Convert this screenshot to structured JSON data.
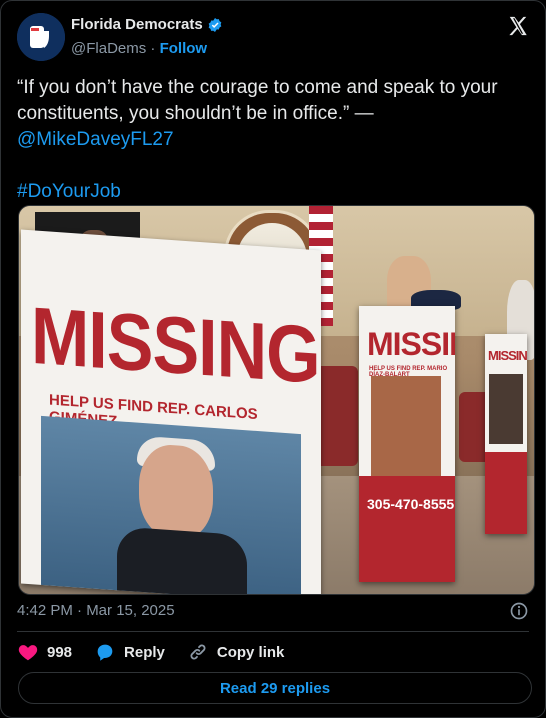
{
  "author": {
    "name": "Florida Democrats",
    "handle": "@FlaDems",
    "separator": "·",
    "follow_label": "Follow"
  },
  "tweet": {
    "text_part1": "“If you don’t have the courage to come and speak to your constituents, you shouldn’t be in office.” — ",
    "mention": "@MikeDaveyFL27",
    "hashtag": "#DoYourJob"
  },
  "media": {
    "poster_big_title": "MISSING",
    "poster_big_subtitle": "HELP US FIND REP. CARLOS GIMÉNEZ",
    "poster_mid_title": "MISSING",
    "poster_mid_subtitle": "HELP US FIND REP. MARIO DÍAZ-BALART",
    "poster_mid_phone": "305-470-8555",
    "poster_small_title": "MISSING"
  },
  "meta": {
    "time": "4:42 PM · Mar 15, 2025"
  },
  "actions": {
    "likes_count": "998",
    "reply_label": "Reply",
    "copy_label": "Copy link",
    "read_replies_label": "Read 29 replies"
  },
  "colors": {
    "accent": "#1d9bf0",
    "like": "#f91880",
    "background": "#000000",
    "muted": "#8b98a5"
  },
  "icons": [
    "florida-logo-icon",
    "verified-badge-icon",
    "x-logo-icon",
    "info-icon",
    "heart-icon",
    "reply-bubble-icon",
    "link-icon"
  ]
}
